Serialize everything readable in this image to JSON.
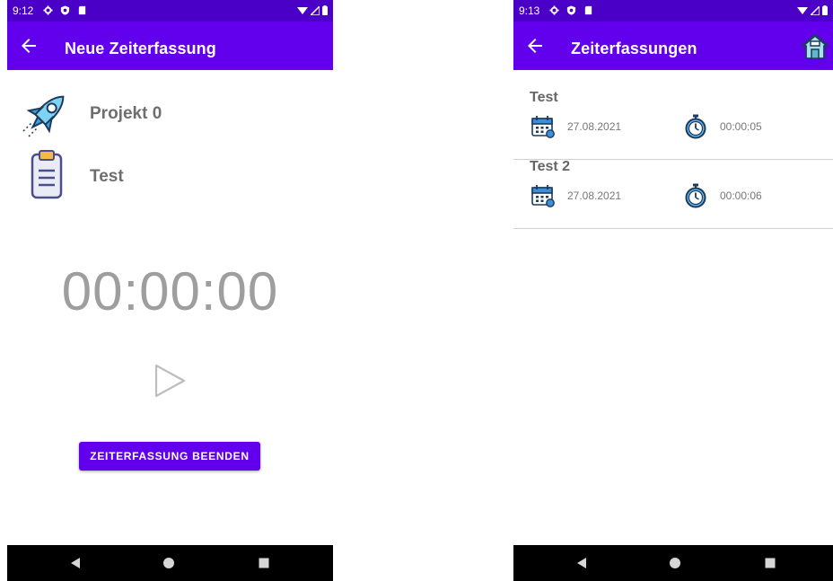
{
  "left_screen": {
    "status_time": "9:12",
    "title": "Neue Zeiterfassung",
    "project_label": "Projekt 0",
    "task_label": "Test",
    "timer": "00:00:00",
    "end_button": "ZEITERFASSUNG BEENDEN"
  },
  "right_screen": {
    "status_time": "9:13",
    "title": "Zeiterfassungen",
    "entries": [
      {
        "title": "Test",
        "date": "27.08.2021",
        "duration": "00:00:05"
      },
      {
        "title": "Test 2",
        "date": "27.08.2021",
        "duration": "00:00:06"
      }
    ]
  },
  "icons": {
    "back": "arrow-left-icon",
    "home": "home-icon",
    "rocket": "rocket-icon",
    "clipboard": "clipboard-icon",
    "play": "play-icon",
    "calendar": "calendar-icon",
    "stopwatch": "stopwatch-icon",
    "nav_back": "nav-back-icon",
    "nav_home": "nav-home-icon",
    "nav_recents": "nav-recents-icon"
  },
  "colors": {
    "status_bar": "#4b00c7",
    "app_bar": "#6200ee",
    "primary_button": "#6200ee",
    "nav_bar": "#000000"
  }
}
